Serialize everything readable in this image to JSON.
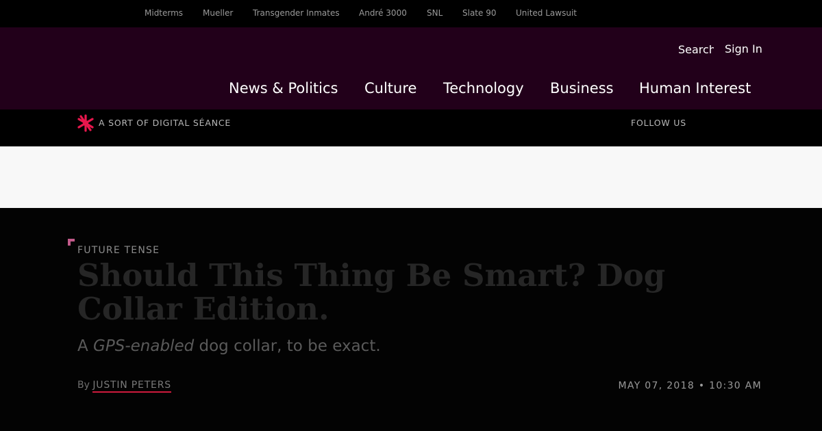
{
  "trending": {
    "items": [
      "Midterms",
      "Mueller",
      "Transgender Inmates",
      "André 3000",
      "SNL",
      "Slate 90",
      "United Lawsuit"
    ]
  },
  "header": {
    "search_placeholder": "Search",
    "sign_in_label": "Sign In",
    "nav": [
      "News & Politics",
      "Culture",
      "Technology",
      "Business",
      "Human Interest"
    ]
  },
  "tagline_bar": {
    "logo_icon": "slate-starburst-icon",
    "tagline": "A SORT OF DIGITAL SÉANCE",
    "follow_label": "FOLLOW US"
  },
  "article": {
    "kicker": "FUTURE TENSE",
    "headline": "Should This Thing Be Smart? Dog Collar Edition.",
    "dek": {
      "before": "A ",
      "emphasis": "GPS-enabled",
      "after": " dog collar, to be exact."
    },
    "byline_prefix": "By",
    "author": "JUSTIN PETERS",
    "date": "MAY 07, 2018",
    "separator": "•",
    "time": "10:30 AM"
  },
  "colors": {
    "header_bg": "#22001a",
    "accent": "#e8174d",
    "ad_band": "#f8f8f8",
    "page_bg": "#000000"
  }
}
